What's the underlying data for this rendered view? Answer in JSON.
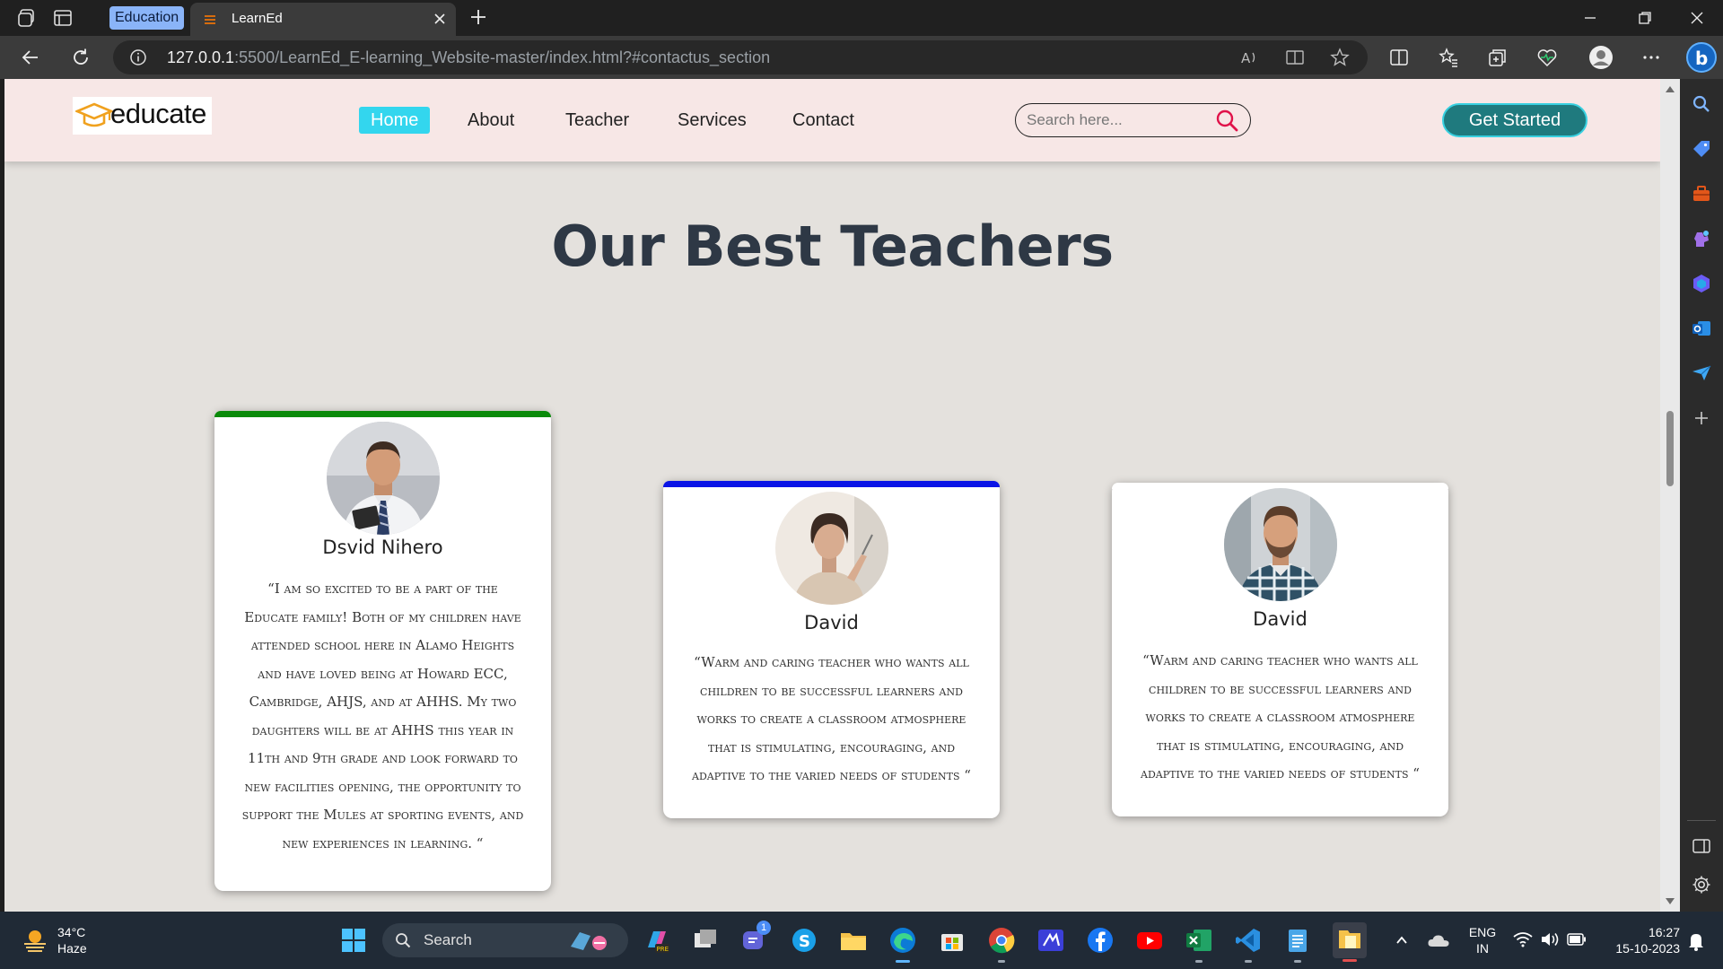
{
  "browser": {
    "tab_group_label": "Education",
    "tab_title": "LearnEd",
    "url_host": "127.0.0.1",
    "url_path": ":5500/LearnEd_E-learning_Website-master/index.html?#contactus_section"
  },
  "site": {
    "logo_text": "educate",
    "nav": [
      "Home",
      "About",
      "Teacher",
      "Services",
      "Contact"
    ],
    "search_placeholder": "Search here...",
    "cta": "Get Started",
    "section_title": "Our Best Teachers",
    "teachers": [
      {
        "name": "Dsvid Nihero",
        "accent": "#0a8a0a",
        "quote": "“I am so excited to be a part of the Educate family! Both of my children have attended school here in Alamo Heights and have loved being at Howard ECC, Cambridge, AHJS, and at AHHS. My two daughters will be at AHHS this year in 11th and 9th grade and look forward to new facilities opening, the opportunity to support the Mules at sporting events, and new experiences in learning. “"
      },
      {
        "name": "David",
        "accent": "#0a14e6",
        "quote": "“Warm and caring teacher who wants all children to be successful learners and works to create a classroom atmosphere that is stimulating, encouraging, and adaptive to the varied needs of students “"
      },
      {
        "name": "David",
        "accent": "#ffffff",
        "quote": "“Warm and caring teacher who wants all children to be successful learners and works to create a classroom atmosphere that is stimulating, encouraging, and adaptive to the varied needs of students “"
      }
    ]
  },
  "taskbar": {
    "weather_temp": "34°C",
    "weather_desc": "Haze",
    "search_label": "Search",
    "teams_badge": "1",
    "lang_line1": "ENG",
    "lang_line2": "IN",
    "time": "16:27",
    "date": "15-10-2023"
  }
}
